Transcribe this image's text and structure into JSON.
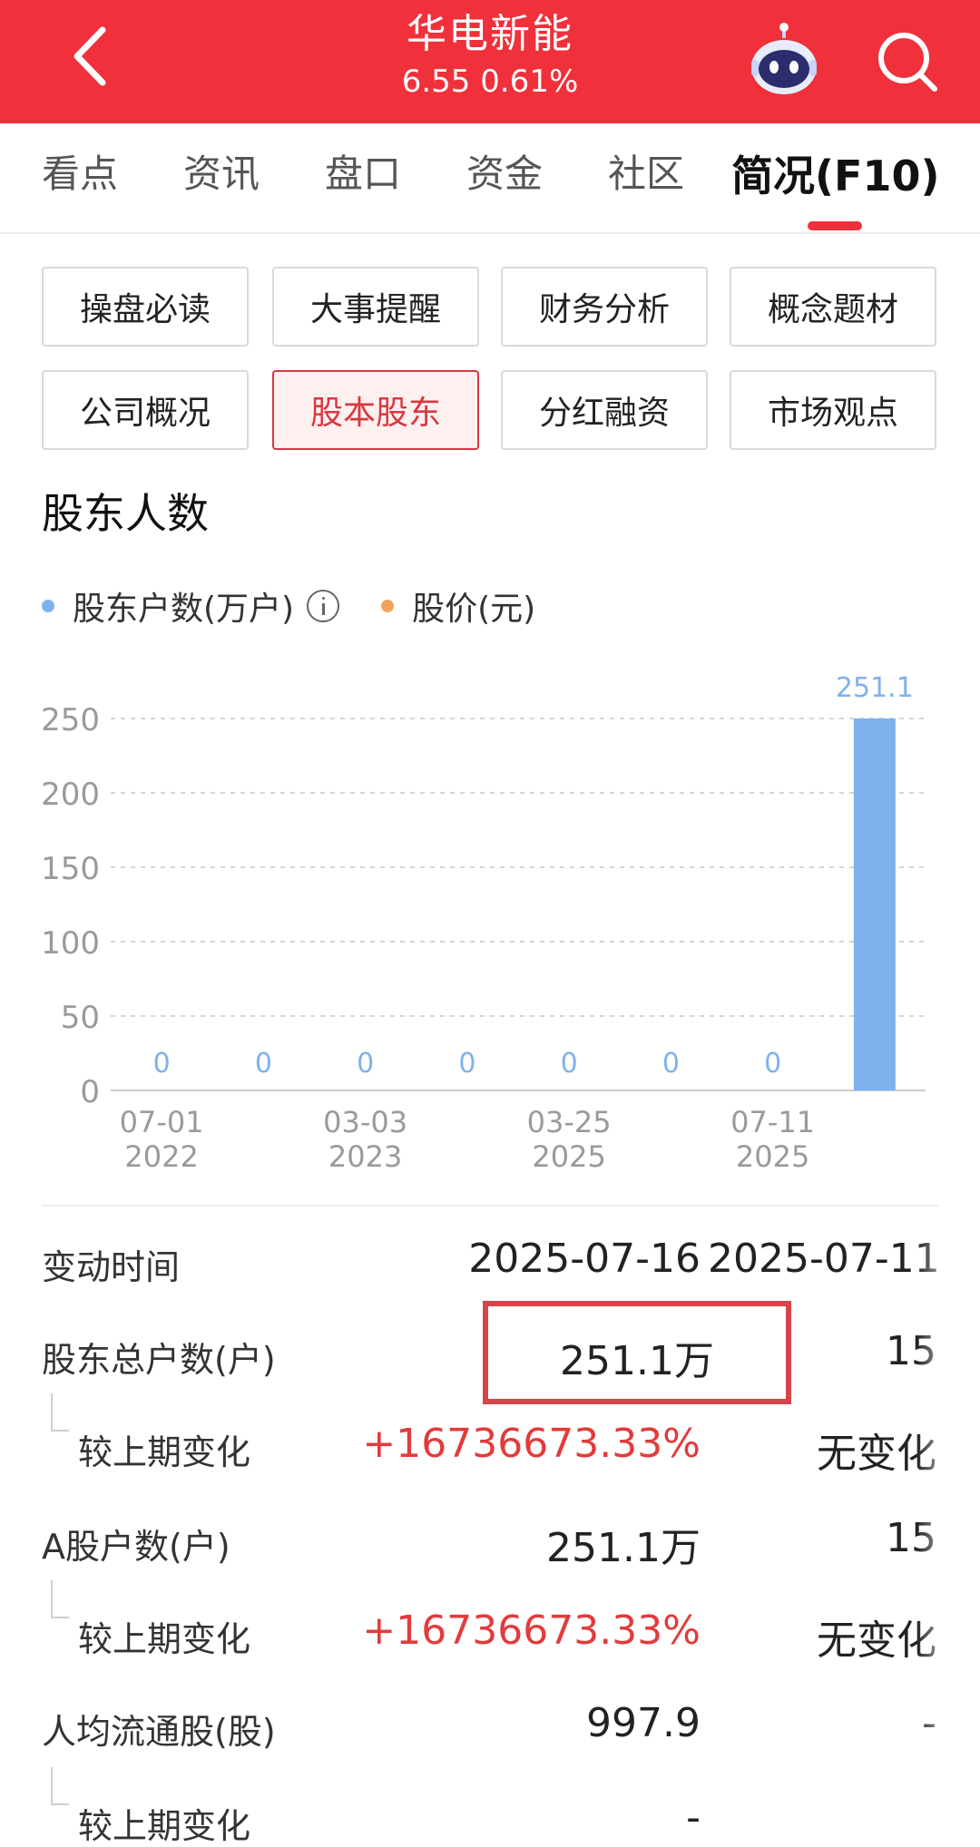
{
  "header": {
    "stock_name": "华电新能",
    "quote": "6.55 0.61%",
    "background": "#f0303a"
  },
  "tabs": [
    {
      "label": "看点",
      "active": false
    },
    {
      "label": "资讯",
      "active": false
    },
    {
      "label": "盘口",
      "active": false
    },
    {
      "label": "资金",
      "active": false
    },
    {
      "label": "社区",
      "active": false
    },
    {
      "label": "简况(F10)",
      "active": true
    }
  ],
  "sub_buttons": [
    {
      "label": "操盘必读",
      "active": false
    },
    {
      "label": "大事提醒",
      "active": false
    },
    {
      "label": "财务分析",
      "active": false
    },
    {
      "label": "概念题材",
      "active": false
    },
    {
      "label": "公司概况",
      "active": false
    },
    {
      "label": "股本股东",
      "active": true
    },
    {
      "label": "分红融资",
      "active": false
    },
    {
      "label": "市场观点",
      "active": false
    }
  ],
  "section": {
    "title": "股东人数",
    "legend": [
      {
        "label": "股东户数(万户)",
        "color": "#7eb2ee",
        "has_info": true
      },
      {
        "label": "股价(元)",
        "color": "#f0a45a",
        "has_info": false
      }
    ]
  },
  "chart_data": {
    "type": "bar",
    "categories": [
      "07-01 2022",
      "",
      "03-03 2023",
      "",
      "03-25 2025",
      "",
      "07-11 2025",
      ""
    ],
    "tick_labels": [
      {
        "line1": "07-01",
        "line2": "2022"
      },
      {
        "line1": "03-03",
        "line2": "2023"
      },
      {
        "line1": "03-25",
        "line2": "2025"
      },
      {
        "line1": "07-11",
        "line2": "2025"
      }
    ],
    "values": [
      0,
      0,
      0,
      0,
      0,
      0,
      0,
      251.1
    ],
    "value_labels": [
      "0",
      "0",
      "0",
      "0",
      "0",
      "0",
      "0",
      "251.1"
    ],
    "y_ticks": [
      "0",
      "50",
      "100",
      "150",
      "200",
      "250"
    ],
    "ylim": [
      0,
      250
    ],
    "grid": true,
    "bar_color": "#7eb2ee",
    "zero_label_color": "#7eb2ee"
  },
  "table": {
    "rows": [
      {
        "label": "变动时间",
        "sub": false,
        "v1": "2025-07-16",
        "v2": "2025-07-11",
        "v1_red": false,
        "v2_red": false
      },
      {
        "label": "股东总户数(户)",
        "sub": false,
        "v1": "251.1万",
        "v2": "15",
        "v1_red": false,
        "v2_red": false
      },
      {
        "label": "较上期变化",
        "sub": true,
        "v1": "+16736673.33%",
        "v2": "无变化",
        "v1_red": true,
        "v2_red": false
      },
      {
        "label": "A股户数(户)",
        "sub": false,
        "v1": "251.1万",
        "v2": "15",
        "v1_red": false,
        "v2_red": false
      },
      {
        "label": "较上期变化",
        "sub": true,
        "v1": "+16736673.33%",
        "v2": "无变化",
        "v1_red": true,
        "v2_red": false
      },
      {
        "label": "人均流通股(股)",
        "sub": false,
        "v1": "997.9",
        "v2": "-",
        "v1_red": false,
        "v2_red": false
      },
      {
        "label": "较上期变化",
        "sub": true,
        "v1": "-",
        "v2": "",
        "v1_red": false,
        "v2_red": false
      }
    ]
  }
}
